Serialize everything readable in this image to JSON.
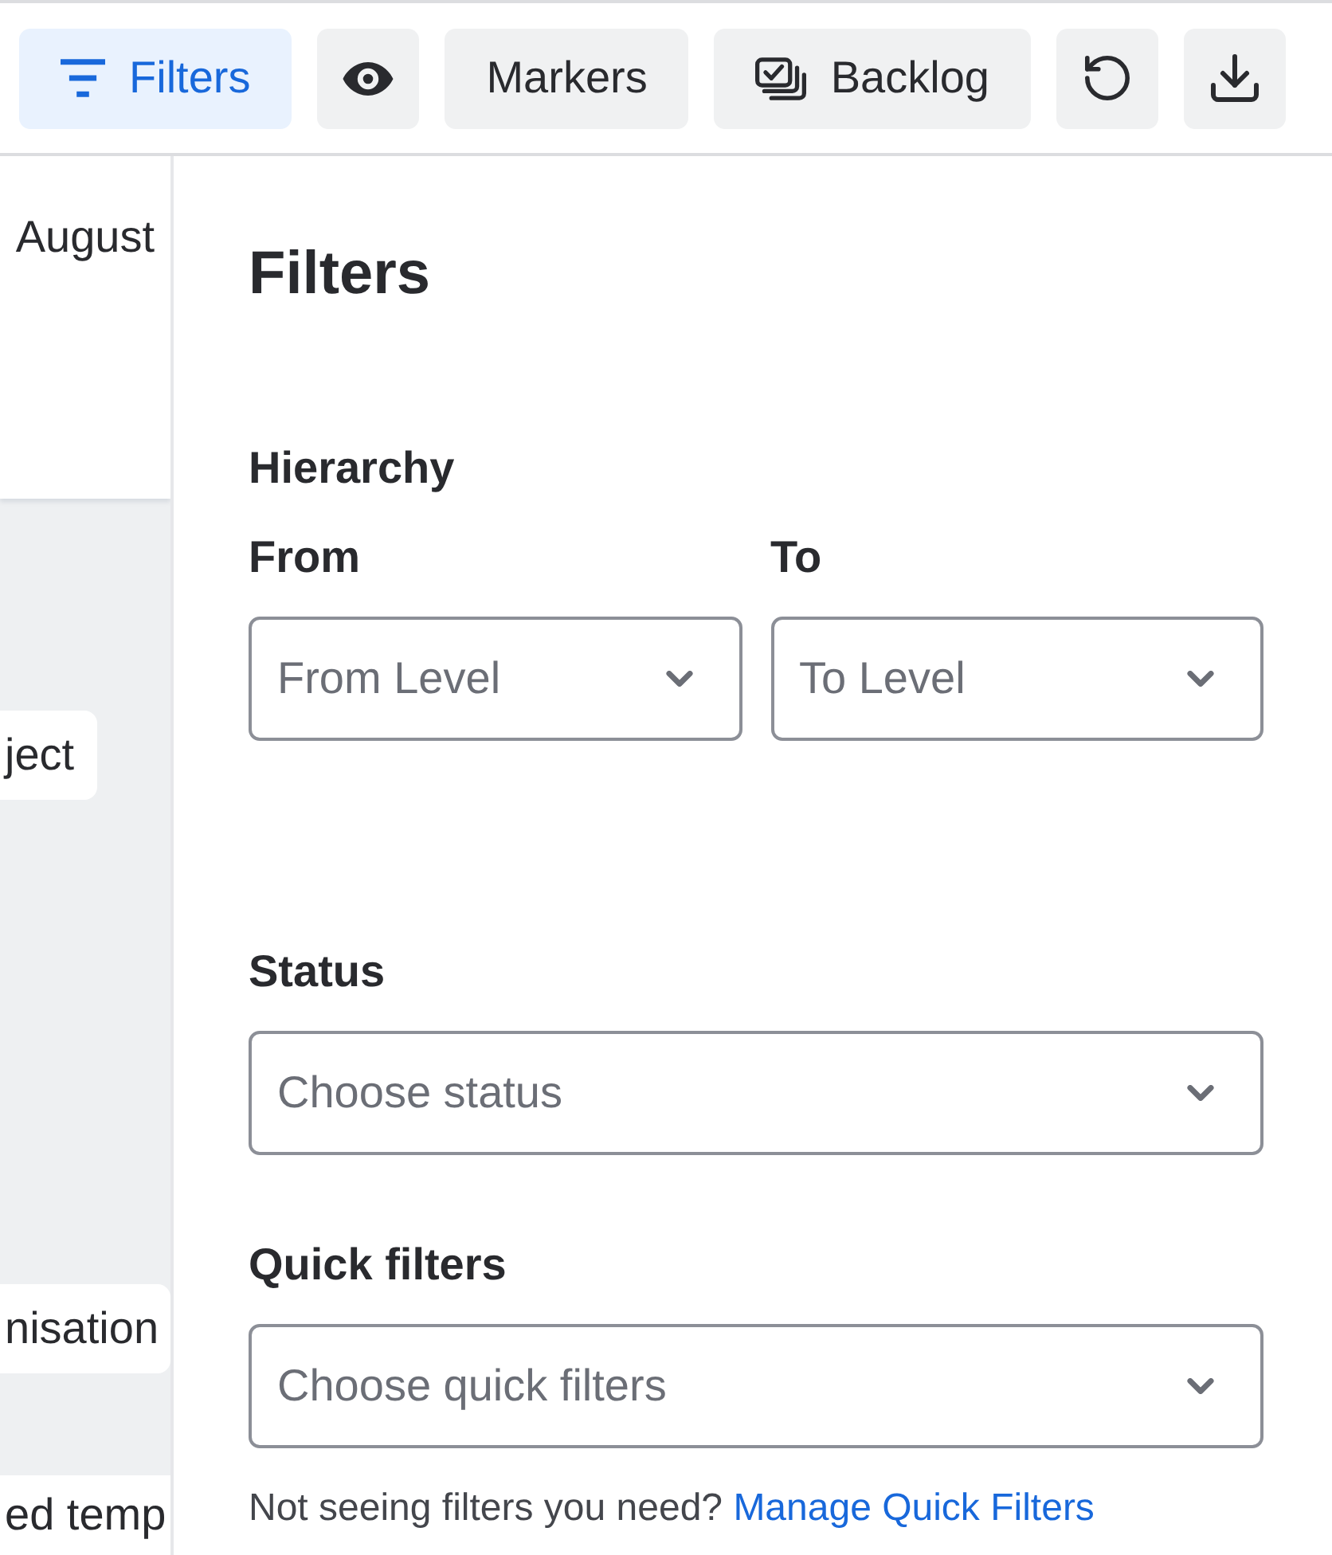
{
  "toolbar": {
    "buttons": [
      {
        "kind": "filters",
        "label": "Filters",
        "selected": true
      },
      {
        "kind": "view",
        "selected": false
      },
      {
        "kind": "markers",
        "label": "Markers",
        "selected": false
      },
      {
        "kind": "backlog",
        "label": "Backlog",
        "selected": false
      },
      {
        "kind": "reset",
        "selected": false
      },
      {
        "kind": "download",
        "selected": false
      }
    ]
  },
  "timeline": {
    "month": "August",
    "bars": [
      {
        "label": "ject"
      },
      {
        "label": "nisation"
      },
      {
        "label": "ed temp"
      }
    ]
  },
  "filters_panel": {
    "title": "Filters",
    "hierarchy": {
      "label": "Hierarchy",
      "from": {
        "label": "From",
        "placeholder": "From Level"
      },
      "to": {
        "label": "To",
        "placeholder": "To Level"
      }
    },
    "status": {
      "label": "Status",
      "placeholder": "Choose status"
    },
    "quick_filters": {
      "label": "Quick filters",
      "placeholder": "Choose quick filters"
    },
    "help_text": "Not seeing filters you need?",
    "help_link": "Manage Quick Filters"
  }
}
